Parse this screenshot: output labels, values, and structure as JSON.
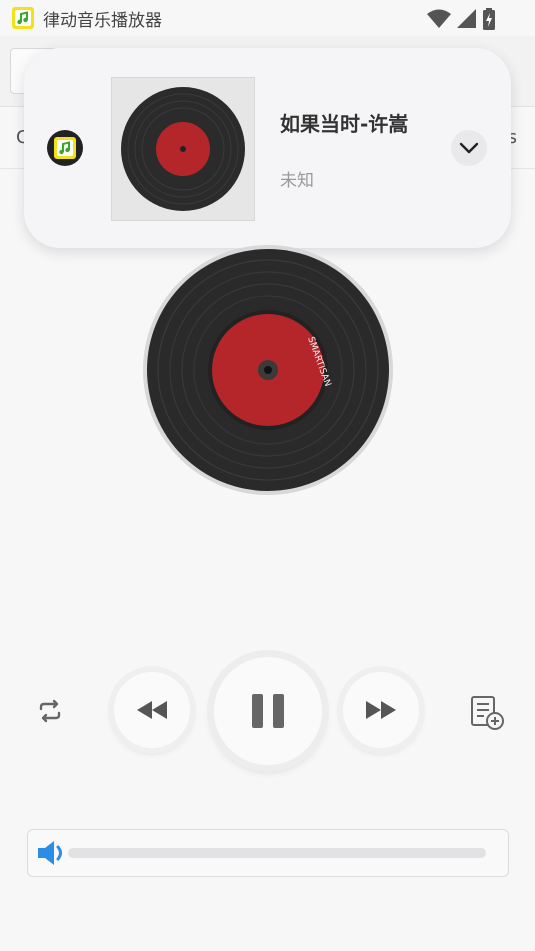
{
  "status_bar": {
    "app_title": "律动音乐播放器",
    "icons": [
      "wifi-icon",
      "signal-icon",
      "battery-charging-icon"
    ]
  },
  "background": {
    "left_letter": "C",
    "right_letter": "s"
  },
  "notification": {
    "app_icon": "music-note-app-icon",
    "song_title": "如果当时-许嵩",
    "artist": "未知",
    "expand_icon": "chevron-down-icon"
  },
  "player": {
    "disc_label": "SMARTISAN",
    "controls": {
      "repeat": "repeat-icon",
      "previous": "rewind-icon",
      "play_pause": "pause-icon",
      "next": "fast-forward-icon",
      "playlist": "playlist-add-icon"
    },
    "volume": {
      "icon": "volume-icon",
      "level": 0.0
    }
  },
  "colors": {
    "accent_blue": "#2a8ee6",
    "label_red": "#b5262b",
    "background": "#f7f7f8"
  }
}
